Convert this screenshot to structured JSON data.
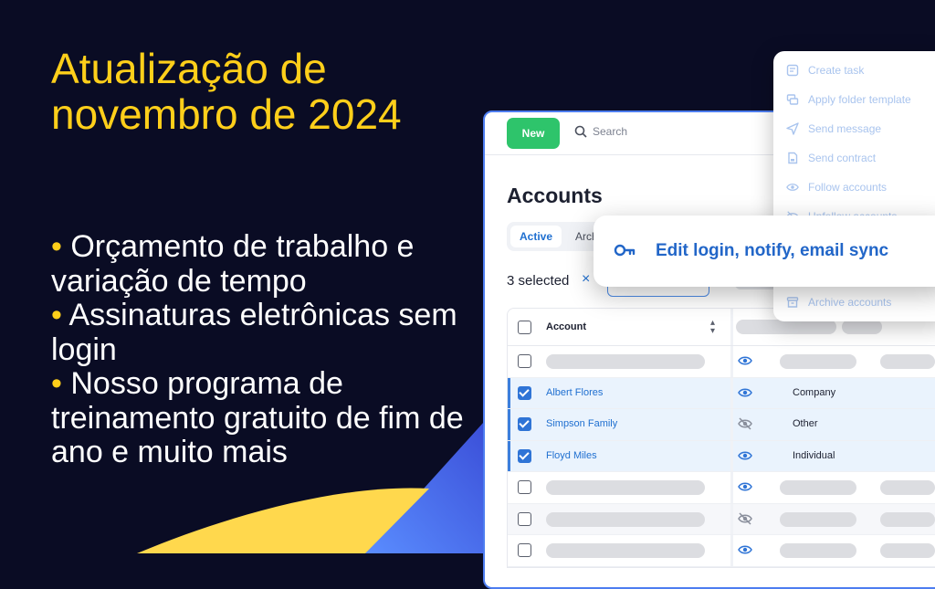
{
  "headline": "Atualização de novembro de 2024",
  "bullets": [
    "Orçamento de trabalho e variação de tempo",
    "Assinaturas eletrônicas sem login",
    "Nosso programa de treinamento gratuito de fim de ano e muito mais"
  ],
  "colors": {
    "background": "#0a0c24",
    "accent": "#ffcf1a",
    "primary": "#1f6fd0",
    "new_button": "#2ec46b"
  },
  "toolbar": {
    "new_label": "New",
    "search_placeholder": "Search"
  },
  "page": {
    "title": "Accounts"
  },
  "tabs": {
    "active": "Active",
    "archived": "Arch"
  },
  "selection": {
    "text": "3 selected",
    "clear": "×"
  },
  "table": {
    "header": {
      "account": "Account"
    },
    "rows": [
      {
        "name": "Albert Flores",
        "type": "Company",
        "checked": true,
        "visibility": "eye-icon"
      },
      {
        "name": "Simpson Family",
        "type": "Other",
        "checked": true,
        "visibility": "eye-off-icon"
      },
      {
        "name": "Floyd Miles",
        "type": "Individual",
        "checked": true,
        "visibility": "eye-icon"
      }
    ]
  },
  "menu": {
    "items": [
      {
        "label": "Create task",
        "icon": "task-icon"
      },
      {
        "label": "Apply folder template",
        "icon": "folder-template-icon"
      },
      {
        "label": "Send message",
        "icon": "send-icon"
      },
      {
        "label": "Send contract",
        "icon": "contract-icon"
      },
      {
        "label": "Follow accounts",
        "icon": "eye-icon"
      },
      {
        "label": "Unfollow accounts",
        "icon": "eye-off-icon"
      },
      {
        "label": "Archive accounts",
        "icon": "archive-icon"
      }
    ]
  },
  "popup": {
    "label": "Edit login, notify, email sync",
    "icon": "key-icon"
  }
}
